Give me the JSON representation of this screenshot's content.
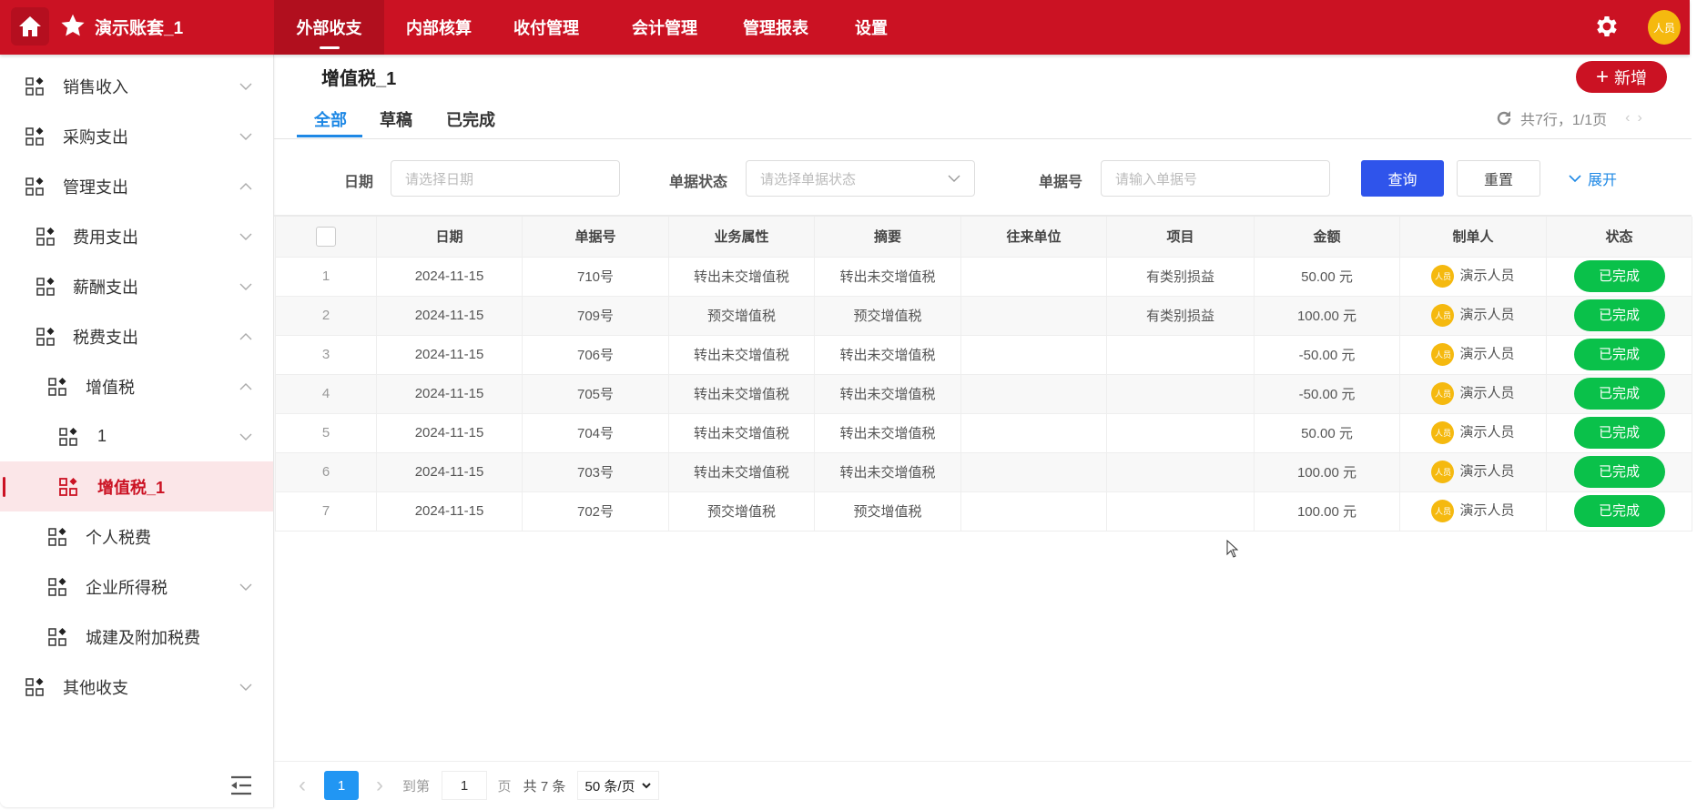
{
  "header": {
    "brand": "演示账套_1",
    "nav": [
      "外部收支",
      "内部核算",
      "收付管理",
      "会计管理",
      "管理报表",
      "设置"
    ],
    "active_nav": 0,
    "avatar": "人员",
    "brand_color": "#cb1223"
  },
  "sidebar": {
    "items": [
      {
        "label": "销售收入",
        "chevron": "down"
      },
      {
        "label": "采购支出",
        "chevron": "down"
      },
      {
        "label": "管理支出",
        "chevron": "up"
      },
      {
        "label": "费用支出",
        "chevron": "down"
      },
      {
        "label": "薪酬支出",
        "chevron": "down"
      },
      {
        "label": "税费支出",
        "chevron": "up"
      },
      {
        "label": "增值税",
        "chevron": "up"
      },
      {
        "label": "1",
        "chevron": "down"
      },
      {
        "label": "增值税_1",
        "chevron": "",
        "active": true
      },
      {
        "label": "个人税费",
        "chevron": ""
      },
      {
        "label": "企业所得税",
        "chevron": "down"
      },
      {
        "label": "城建及附加税费",
        "chevron": ""
      },
      {
        "label": "其他收支",
        "chevron": "down"
      }
    ]
  },
  "main": {
    "title": "增值税_1",
    "add_label": "新增",
    "tabs": [
      "全部",
      "草稿",
      "已完成"
    ],
    "page_info": "共7行，1/1页",
    "filters": {
      "date_label": "日期",
      "date_placeholder": "请选择日期",
      "status_label": "单据状态",
      "status_placeholder": "请选择单据状态",
      "no_label": "单据号",
      "no_placeholder": "请输入单据号",
      "query": "查询",
      "reset": "重置",
      "expand": "展开"
    },
    "table": {
      "columns": [
        "日期",
        "单据号",
        "业务属性",
        "摘要",
        "往来单位",
        "项目",
        "金额",
        "制单人",
        "状态"
      ],
      "rows": [
        [
          "1",
          "2024-11-15",
          "710号",
          "转出未交增值税",
          "转出未交增值税",
          "",
          "有类别损益",
          "50.00 元",
          "演示人员",
          "已完成"
        ],
        [
          "2",
          "2024-11-15",
          "709号",
          "预交增值税",
          "预交增值税",
          "",
          "有类别损益",
          "100.00 元",
          "演示人员",
          "已完成"
        ],
        [
          "3",
          "2024-11-15",
          "706号",
          "转出未交增值税",
          "转出未交增值税",
          "",
          "",
          "-50.00 元",
          "演示人员",
          "已完成"
        ],
        [
          "4",
          "2024-11-15",
          "705号",
          "转出未交增值税",
          "转出未交增值税",
          "",
          "",
          "-50.00 元",
          "演示人员",
          "已完成"
        ],
        [
          "5",
          "2024-11-15",
          "704号",
          "转出未交增值税",
          "转出未交增值税",
          "",
          "",
          "50.00 元",
          "演示人员",
          "已完成"
        ],
        [
          "6",
          "2024-11-15",
          "703号",
          "转出未交增值税",
          "转出未交增值税",
          "",
          "",
          "100.00 元",
          "演示人员",
          "已完成"
        ],
        [
          "7",
          "2024-11-15",
          "702号",
          "预交增值税",
          "预交增值税",
          "",
          "",
          "100.00 元",
          "演示人员",
          "已完成"
        ]
      ],
      "avatar_text": "人员"
    },
    "pagination": {
      "current": "1",
      "goto_label": "到第",
      "goto_value": "1",
      "page_unit": "页",
      "total": "共 7 条",
      "page_size": "50 条/页"
    }
  }
}
